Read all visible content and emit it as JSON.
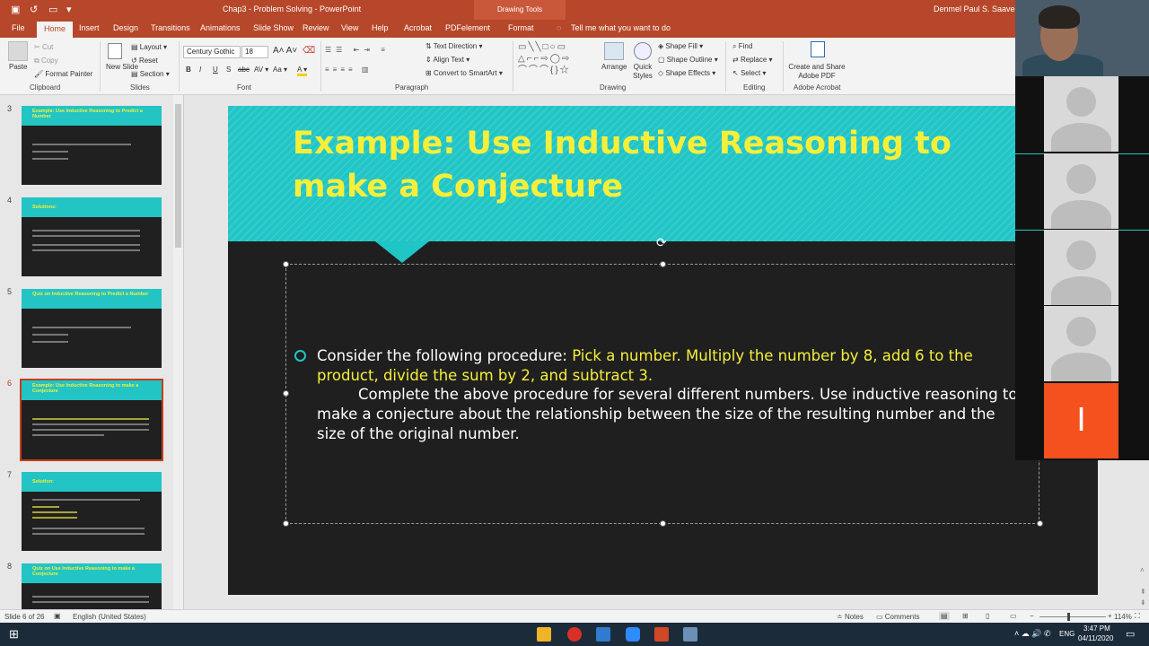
{
  "window": {
    "doc_title": "Chap3 - Problem Solving - PowerPoint",
    "drawing_tools": "Drawing Tools",
    "user": "Denmel Paul S. Saavedra"
  },
  "tabs": [
    "File",
    "Home",
    "Insert",
    "Design",
    "Transitions",
    "Animations",
    "Slide Show",
    "Review",
    "View",
    "Help",
    "Acrobat",
    "PDFelement",
    "Format"
  ],
  "tell_me": "Tell me what you want to do",
  "ribbon": {
    "clipboard": {
      "label": "Clipboard",
      "paste": "Paste",
      "cut": "Cut",
      "copy": "Copy",
      "format_painter": "Format Painter"
    },
    "slides": {
      "label": "Slides",
      "new_slide": "New Slide",
      "layout": "Layout",
      "reset": "Reset",
      "section": "Section"
    },
    "font": {
      "label": "Font",
      "name": "Century Gothic",
      "size": "18"
    },
    "paragraph": {
      "label": "Paragraph",
      "text_direction": "Text Direction",
      "align_text": "Align Text",
      "convert_smartart": "Convert to SmartArt"
    },
    "drawing": {
      "label": "Drawing",
      "arrange": "Arrange",
      "quick_styles": "Quick Styles",
      "shape_fill": "Shape Fill",
      "shape_outline": "Shape Outline",
      "shape_effects": "Shape Effects"
    },
    "editing": {
      "label": "Editing",
      "find": "Find",
      "replace": "Replace",
      "select": "Select"
    },
    "adobe": {
      "label": "Adobe Acrobat",
      "create_share": "Create and Share Adobe PDF"
    }
  },
  "thumbnails": [
    {
      "num": "3",
      "title": "Example: Use Inductive Reasoning to Predict a Number"
    },
    {
      "num": "4",
      "title": "Solutions:"
    },
    {
      "num": "5",
      "title": "Quiz on Inductive Reasoning to Predict a Number"
    },
    {
      "num": "6",
      "title": "Example: Use Inductive Reasoning to make a Conjecture"
    },
    {
      "num": "7",
      "title": "Solution:"
    },
    {
      "num": "8",
      "title": "Quiz on Use Inductive Reasoning to make a Conjecture"
    }
  ],
  "slide": {
    "title": "Example: Use Inductive Reasoning to make a Conjecture",
    "p1_white": "Consider the following procedure: ",
    "p1_yellow": "Pick a number. Multiply the number by 8, add 6 to the product, divide the sum by 2, and subtract 3.",
    "p2": "Complete the above procedure for several different numbers. Use inductive reasoning to make a conjecture about the relationship between the size of the resulting number and the size of the original number."
  },
  "status": {
    "slide_info": "Slide 6 of 26",
    "language": "English (United States)",
    "notes": "Notes",
    "comments": "Comments",
    "zoom": "114%"
  },
  "taskbar": {
    "time": "3:47 PM",
    "date": "04/11/2020",
    "lang": "ENG"
  },
  "colors": {
    "accent": "#b7472a",
    "teal": "#20c5c6",
    "yellow": "#f6ef3a",
    "slide_bg": "#1f1f1f"
  }
}
